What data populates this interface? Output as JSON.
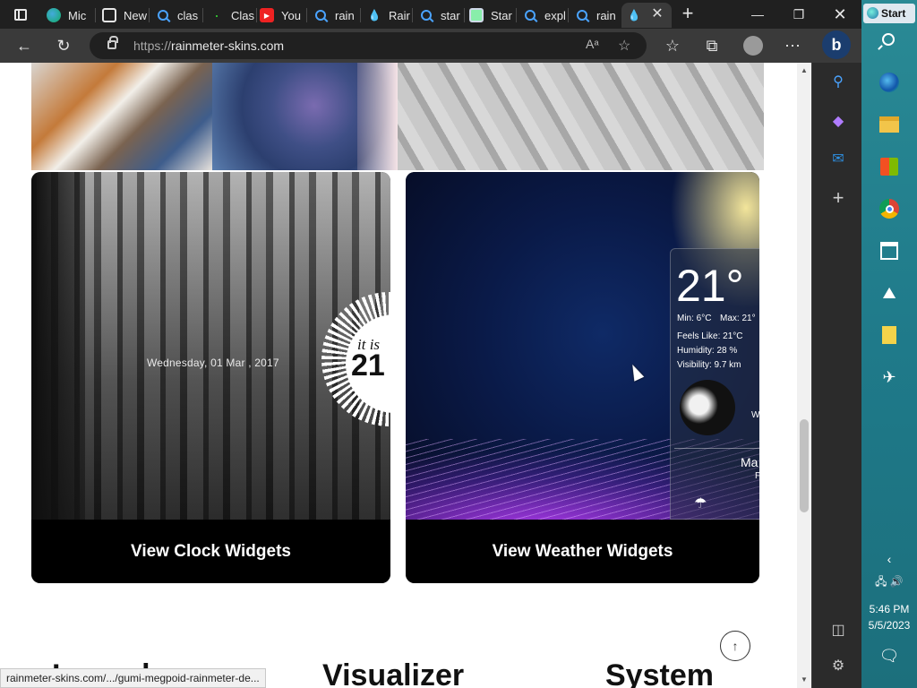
{
  "browser": {
    "tabs": [
      {
        "label": "Mic",
        "icon": "edge-icon"
      },
      {
        "label": "New",
        "icon": "news-icon"
      },
      {
        "label": "clas",
        "icon": "search-icon"
      },
      {
        "label": "Clas",
        "icon": "dots-icon"
      },
      {
        "label": "You",
        "icon": "youtube-icon"
      },
      {
        "label": "rain",
        "icon": "search-icon"
      },
      {
        "label": "Rair",
        "icon": "drop-icon"
      },
      {
        "label": "star",
        "icon": "search-icon"
      },
      {
        "label": "Star",
        "icon": "book-icon"
      },
      {
        "label": "expl",
        "icon": "search-icon"
      },
      {
        "label": "rain",
        "icon": "search-icon"
      },
      {
        "label": "",
        "icon": "rainmeter-icon",
        "active": true
      }
    ],
    "url_proto": "https://",
    "url_host": "rainmeter-skins.com",
    "bing_label": "b"
  },
  "page": {
    "clock_card": {
      "date_text": "Wednesday, 01 Mar , 2017",
      "it_is": "it is",
      "hour": "21",
      "label": "View Clock Widgets"
    },
    "weather_card": {
      "temp": "21°",
      "minmax_min": "Min: 6°C",
      "minmax_max": "Max: 21°",
      "feels": "Feels Like: 21°C",
      "humidity": "Humidity: 28 %",
      "visibility": "Visibility: 9.7 km",
      "w_letter": "W",
      "ma_text": "Ma",
      "f_text": "F",
      "label": "View Weather Widgets"
    },
    "headings": {
      "left": "Launch",
      "mid": "Visualizer",
      "right": "System"
    },
    "back_to_top": "↑",
    "status_link": "rainmeter-skins.com/.../gumi-megpoid-rainmeter-de..."
  },
  "taskbar": {
    "start_label": "Start",
    "time": "5:46 PM",
    "date": "5/5/2023"
  }
}
